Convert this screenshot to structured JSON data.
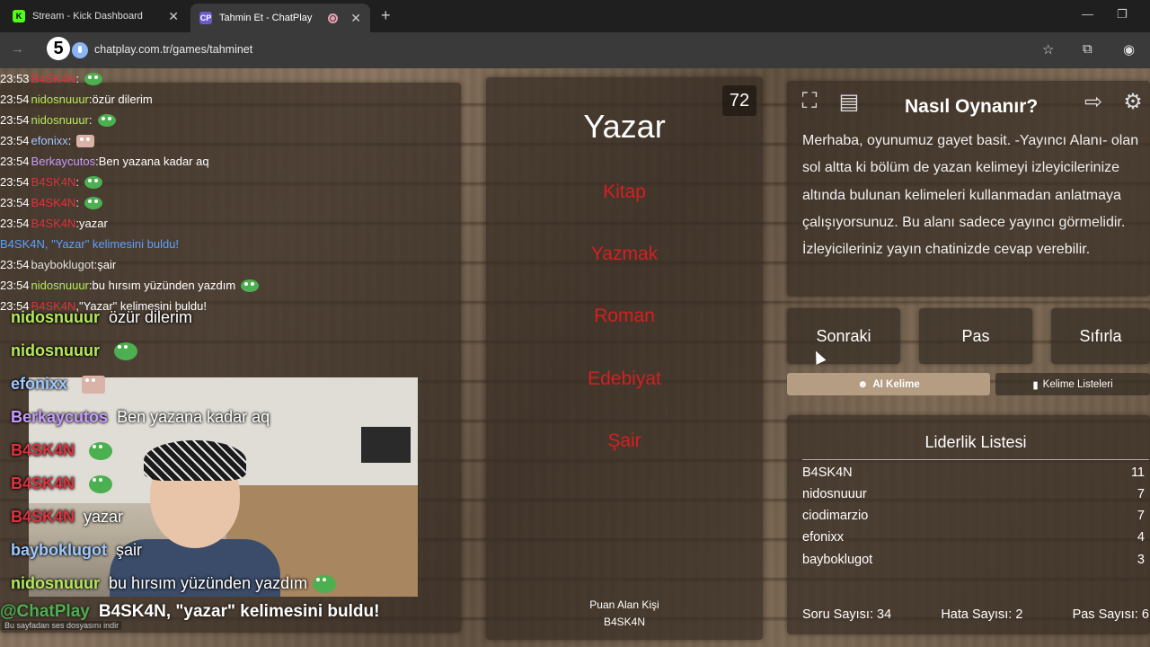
{
  "browser": {
    "tabs": [
      {
        "label": "Stream - Kick Dashboard",
        "favicon": "K",
        "color": "#53fc18"
      },
      {
        "label": "Tahmin Et - ChatPlay",
        "favicon": "CP",
        "color": "#6a5acd"
      }
    ],
    "url": "chatplay.com.tr/games/tahminet",
    "step_badge": "5"
  },
  "chat": {
    "lines": [
      {
        "time": "23:53",
        "user": "B4SK4N",
        "sep": ":",
        "msg": "",
        "color": "#e0323c",
        "emote": "pepe"
      },
      {
        "time": "23:54",
        "user": "nidosnuuur",
        "sep": ":",
        "msg": " özür dilerim",
        "color": "#b5e85a"
      },
      {
        "time": "23:54",
        "user": "nidosnuuur",
        "sep": ":",
        "msg": "",
        "color": "#b5e85a",
        "emote": "pepe"
      },
      {
        "time": "23:54",
        "user": "efonixx",
        "sep": ":",
        "msg": "",
        "color": "#9ec8ff",
        "emote": "cat"
      },
      {
        "time": "23:54",
        "user": "Berkaycutos",
        "sep": ":",
        "msg": " Ben yazana kadar aq",
        "color": "#c79bff"
      },
      {
        "time": "23:54",
        "user": "B4SK4N",
        "sep": ":",
        "msg": "",
        "color": "#e0323c",
        "emote": "pepe"
      },
      {
        "time": "23:54",
        "user": "B4SK4N",
        "sep": ":",
        "msg": "",
        "color": "#e0323c",
        "emote": "pepe"
      },
      {
        "time": "23:54",
        "user": "B4SK4N",
        "sep": ":",
        "msg": " yazar",
        "color": "#e0323c"
      },
      {
        "system": true,
        "text": "B4SK4N, \"Yazar\" kelimesini buldu!"
      },
      {
        "time": "23:54",
        "user": "bayboklugot",
        "sep": ":",
        "msg": " şair",
        "color": "#e0e0e0"
      },
      {
        "time": "23:54",
        "user": "nidosnuuur",
        "sep": ":",
        "msg": " bu hırsım yüzünden yazdım",
        "color": "#b5e85a",
        "emote": "pepe"
      },
      {
        "time": "23:54",
        "user": "B4SK4N",
        "sep": ",",
        "msg": " \"Yazar\" kelimesini buldu!",
        "color": "#e0323c"
      }
    ],
    "overlay": [
      {
        "user": "nidosnuuur",
        "msg": "özür dilerim",
        "color": "#b5e85a"
      },
      {
        "user": "nidosnuuur",
        "msg": "",
        "color": "#b5e85a",
        "emote": "pepe"
      },
      {
        "user": "efonixx",
        "msg": "",
        "color": "#9ec8ff",
        "emote": "cat"
      },
      {
        "user": "Berkaycutos",
        "msg": "Ben yazana kadar aq",
        "color": "#c79bff"
      },
      {
        "user": "B4SK4N",
        "msg": "",
        "color": "#e0323c",
        "emote": "pepe"
      },
      {
        "user": "B4SK4N",
        "msg": "",
        "color": "#e0323c",
        "emote": "pepe"
      },
      {
        "user": "B4SK4N",
        "msg": "yazar",
        "color": "#e0323c"
      },
      {
        "user": "bayboklugot",
        "msg": "şair",
        "color": "#9ec8ff"
      },
      {
        "user": "nidosnuuur",
        "msg": "bu hırsım yüzünden yazdım",
        "color": "#b5e85a",
        "emote": "pepe"
      }
    ],
    "chatplay_name": "@ChatPlay",
    "chatplay_msg": "B4SK4N, \"yazar\" kelimesini buldu!",
    "download_notice": "Bu sayfadan ses dosyasını indir"
  },
  "game": {
    "timer": "72",
    "word": "Yazar",
    "taboo": [
      "Kitap",
      "Yazmak",
      "Roman",
      "Edebiyat",
      "Şair"
    ],
    "scorer_label": "Puan Alan Kişi",
    "scorer_name": "B4SK4N"
  },
  "howto": {
    "title": "Nasıl Oynanır?",
    "text": "Merhaba, oyunumuz gayet basit. -Yayıncı Alanı- olan sol altta ki bölüm de yazan kelimeyi izleyicilerinize altında bulunan kelimeleri kullanmadan anlatmaya çalışıyorsunuz. Bu alanı sadece yayıncı görmelidir. İzleyicileriniz yayın chatinizde cevap verebilir."
  },
  "controls": {
    "next": "Sonraki",
    "pass": "Pas",
    "reset": "Sıfırla",
    "ai_word": "AI Kelime",
    "word_lists": "Kelime Listeleri"
  },
  "leaderboard": {
    "title": "Liderlik Listesi",
    "rows": [
      {
        "name": "B4SK4N",
        "score": "11"
      },
      {
        "name": "nidosnuuur",
        "score": "7"
      },
      {
        "name": "ciodimarzio",
        "score": "7"
      },
      {
        "name": "efonixx",
        "score": "4"
      },
      {
        "name": "bayboklugot",
        "score": "3"
      }
    ],
    "questions": "Soru Sayısı: 34",
    "errors": "Hata Sayısı: 2",
    "passes": "Pas Sayısı: 6"
  }
}
